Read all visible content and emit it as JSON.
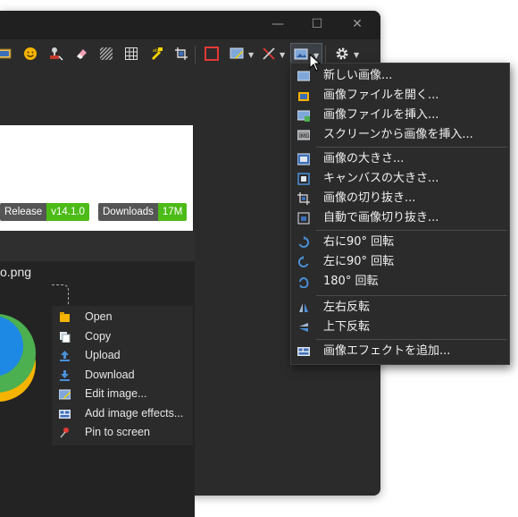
{
  "window": {
    "minimize_glyph": "—",
    "maximize_glyph": "☐",
    "close_glyph": "✕"
  },
  "toolbar": {
    "icons": [
      "image-icon",
      "smiley-icon",
      "stamp-icon",
      "eraser-icon",
      "blur-icon",
      "grid-icon",
      "highlighter-icon",
      "crop-icon",
      "rectangle-icon",
      "image-effect-icon",
      "tools-icon",
      "image-menu-icon",
      "gear-icon"
    ]
  },
  "page": {
    "badges": [
      {
        "key": "Release",
        "value": "v14.1.0"
      },
      {
        "key": "Downloads",
        "value": "17M"
      }
    ],
    "filename": "o.png"
  },
  "context_menu": {
    "items": [
      {
        "label": "Open",
        "icon": "folder-icon"
      },
      {
        "label": "Copy",
        "icon": "copy-icon"
      },
      {
        "label": "Upload",
        "icon": "upload-icon"
      },
      {
        "label": "Download",
        "icon": "download-icon"
      },
      {
        "label": "Edit image...",
        "icon": "edit-image-icon"
      },
      {
        "label": "Add image effects...",
        "icon": "image-effects-icon"
      },
      {
        "label": "Pin to screen",
        "icon": "pin-icon"
      }
    ]
  },
  "image_menu": {
    "items": [
      {
        "label": "新しい画像...",
        "icon": "new-image-icon"
      },
      {
        "label": "画像ファイルを開く...",
        "icon": "open-image-icon"
      },
      {
        "label": "画像ファイルを挿入...",
        "icon": "insert-image-icon"
      },
      {
        "label": "スクリーンから画像を挿入...",
        "icon": "insert-screen-icon"
      },
      {
        "label": "画像の大きさ...",
        "icon": "image-size-icon"
      },
      {
        "label": "キャンバスの大きさ...",
        "icon": "canvas-size-icon"
      },
      {
        "label": "画像の切り抜き...",
        "icon": "crop-image-icon"
      },
      {
        "label": "自動で画像切り抜き...",
        "icon": "auto-crop-icon"
      },
      {
        "label": "右に90° 回転",
        "icon": "rotate-right-icon"
      },
      {
        "label": "左に90° 回転",
        "icon": "rotate-left-icon"
      },
      {
        "label": "180° 回転",
        "icon": "rotate-180-icon"
      },
      {
        "label": "左右反転",
        "icon": "flip-horizontal-icon"
      },
      {
        "label": "上下反転",
        "icon": "flip-vertical-icon"
      },
      {
        "label": "画像エフェクトを追加...",
        "icon": "add-effect-icon"
      }
    ]
  }
}
